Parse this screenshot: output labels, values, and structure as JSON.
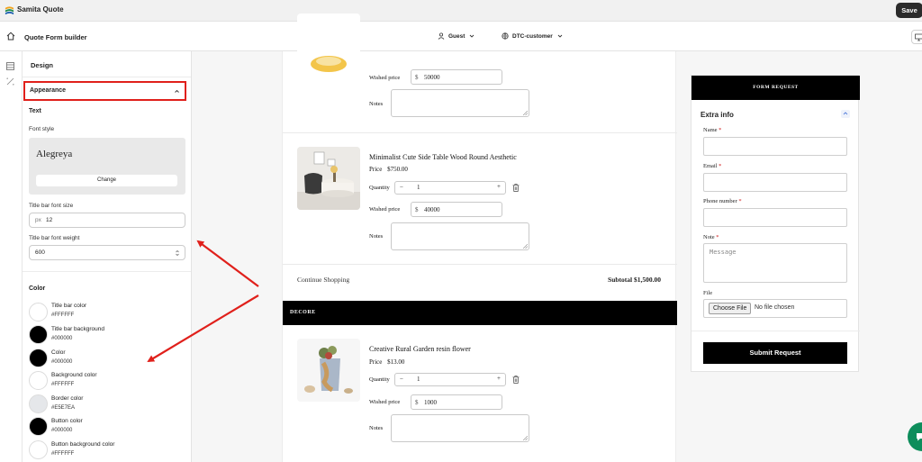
{
  "app": {
    "title": "Samita Quote",
    "save_label": "Save"
  },
  "builder": {
    "title": "Quote Form builder",
    "user_select": "Guest",
    "customer_select": "DTC-customer"
  },
  "panel": {
    "heading": "Design",
    "section": "Appearance",
    "text_heading": "Text",
    "font_style_label": "Font style",
    "font_name": "Alegreya",
    "change_label": "Change",
    "title_size_label": "Title bar font size",
    "title_size_prefix": "px",
    "title_size_value": "12",
    "title_weight_label": "Title bar font weight",
    "title_weight_value": "600",
    "color_heading": "Color",
    "colors": [
      {
        "name": "Title bar color",
        "hex": "#FFFFFF"
      },
      {
        "name": "Title bar background",
        "hex": "#000000"
      },
      {
        "name": "Color",
        "hex": "#000000"
      },
      {
        "name": "Background color",
        "hex": "#FFFFFF"
      },
      {
        "name": "Border color",
        "hex": "#E5E7EA"
      },
      {
        "name": "Button color",
        "hex": "#000000"
      },
      {
        "name": "Button background color",
        "hex": "#FFFFFF"
      }
    ]
  },
  "cart": {
    "item0": {
      "wished_label": "Wished price",
      "currency": "$",
      "wished_value": "50000",
      "notes_label": "Notes"
    },
    "item1": {
      "title": "Minimalist Cute Side Table Wood Round Aesthetic",
      "price_label": "Price",
      "price": "$750.00",
      "qty_label": "Quantity",
      "qty": "1",
      "minus": "−",
      "plus": "+",
      "wished_label": "Wished price",
      "currency": "$",
      "wished_value": "40000",
      "notes_label": "Notes"
    },
    "continue_label": "Continue Shopping",
    "subtotal": "Subtotal $1,500.00",
    "decore_heading": "DECORE",
    "item2": {
      "title": "Creative Rural Garden resin flower",
      "price_label": "Price",
      "price": "$13.00",
      "qty_label": "Quantity",
      "qty": "1",
      "minus": "−",
      "plus": "+",
      "wished_label": "Wished price",
      "currency": "$",
      "wished_value": "1000",
      "notes_label": "Notes"
    }
  },
  "form": {
    "header": "FORM REQUEST",
    "section_title": "Extra info",
    "name_label": "Name",
    "email_label": "Email",
    "phone_label": "Phone number",
    "note_label": "Note",
    "note_placeholder": "Message",
    "required_mark": "*",
    "file_label": "File",
    "choose_file": "Choose File",
    "no_file": "No file chosen",
    "submit_label": "Submit Request"
  }
}
